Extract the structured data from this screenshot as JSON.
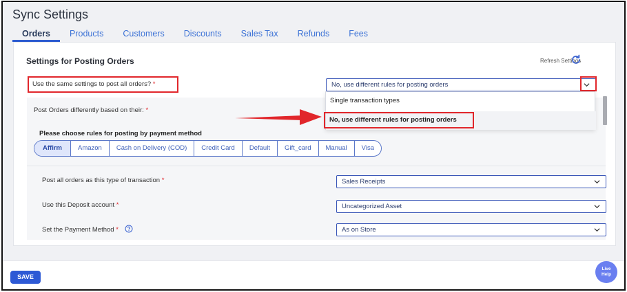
{
  "page": {
    "title": "Sync Settings"
  },
  "tabs": [
    {
      "label": "Orders"
    },
    {
      "label": "Products"
    },
    {
      "label": "Customers"
    },
    {
      "label": "Discounts"
    },
    {
      "label": "Sales Tax"
    },
    {
      "label": "Refunds"
    },
    {
      "label": "Fees"
    }
  ],
  "settings": {
    "title": "Settings for Posting Orders",
    "refresh_label": "Refresh Settings",
    "same_settings_label": "Use the same settings to post all orders?",
    "same_settings_required": "*",
    "same_settings_value": "No, use different rules for posting orders",
    "post_diff_label": "Post Orders differently based on their:",
    "post_diff_required": "*",
    "choose_rules_label": "Please choose rules for posting by payment method"
  },
  "dropdown": {
    "options": [
      {
        "label": "Single transaction types"
      },
      {
        "label": "No, use different rules for posting orders"
      }
    ]
  },
  "payment_methods": [
    {
      "label": "Affirm"
    },
    {
      "label": "Amazon"
    },
    {
      "label": "Cash on Delivery (COD)"
    },
    {
      "label": "Credit Card"
    },
    {
      "label": "Default"
    },
    {
      "label": "Gift_card"
    },
    {
      "label": "Manual"
    },
    {
      "label": "Visa"
    }
  ],
  "rows": [
    {
      "label": "Post all orders as this type of transaction",
      "required": "*",
      "value": "Sales Receipts"
    },
    {
      "label": "Use this Deposit account",
      "required": "*",
      "value": "Uncategorized Asset"
    },
    {
      "label": "Set the Payment Method",
      "required": "*",
      "value": "As on Store"
    }
  ],
  "footer": {
    "save_label": "SAVE",
    "live_help_line1": "Live",
    "live_help_line2": "Help"
  },
  "colors": {
    "accent": "#2d59d5",
    "highlight_red": "#e1262b",
    "tab_blue": "#3d73d6"
  },
  "icons": {
    "refresh": "refresh-icon",
    "chevron": "chevron-down-icon",
    "help": "help-circle-icon",
    "arrow": "red-arrow-annotation"
  }
}
